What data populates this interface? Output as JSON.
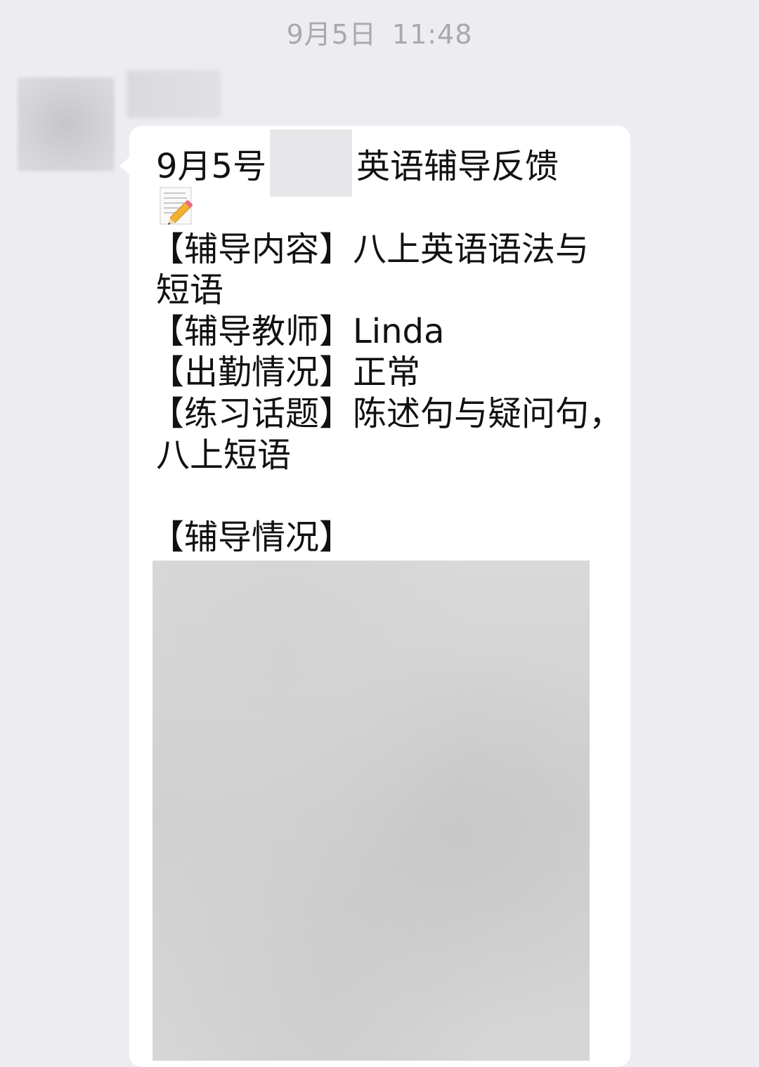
{
  "timestamp": {
    "date": "9月5日",
    "time": "11:48"
  },
  "message": {
    "title_prefix": "9月5号",
    "title_suffix": "英语辅导反馈",
    "content_line1": "【辅导内容】八上英语语法与",
    "content_line2": "短语",
    "teacher_line": "【辅导教师】Linda",
    "attendance_line": "【出勤情况】正常",
    "topic_line1": "【练习话题】陈述句与疑问句，",
    "topic_line2": "八上短语",
    "status_heading": "【辅导情况】",
    "icon": "memo-pencil-icon"
  }
}
